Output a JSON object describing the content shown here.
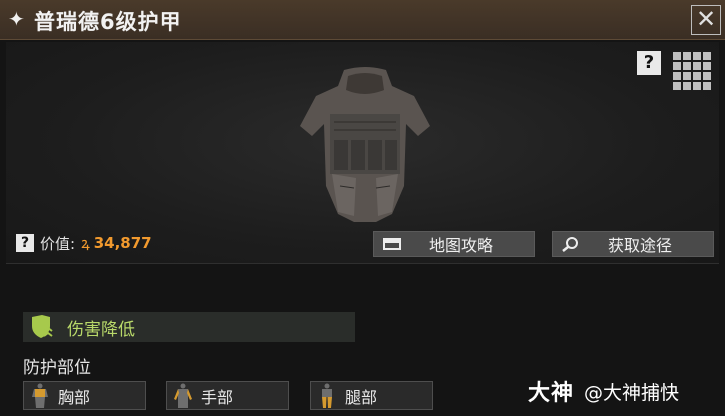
{
  "window": {
    "title": "普瑞德6级护甲",
    "title_icon": "sparkle-icon",
    "close_glyph": "✕"
  },
  "panel": {
    "help_glyph": "?",
    "value_label": "价值:",
    "value_amount": "34,877",
    "coin_glyph": "ꝝ"
  },
  "buttons": {
    "map_guide": "地图攻略",
    "get_source": "获取途径"
  },
  "effects": {
    "damage_reduction": "伤害降低"
  },
  "protection": {
    "title": "防护部位",
    "parts": [
      "胸部",
      "手部",
      "腿部"
    ]
  },
  "watermark": {
    "brand": "大神",
    "handle": "@大神捕快"
  },
  "colors": {
    "accent_value": "#f29a2e",
    "effect_green": "#b9d96a",
    "body_part": "#d59a2f"
  }
}
